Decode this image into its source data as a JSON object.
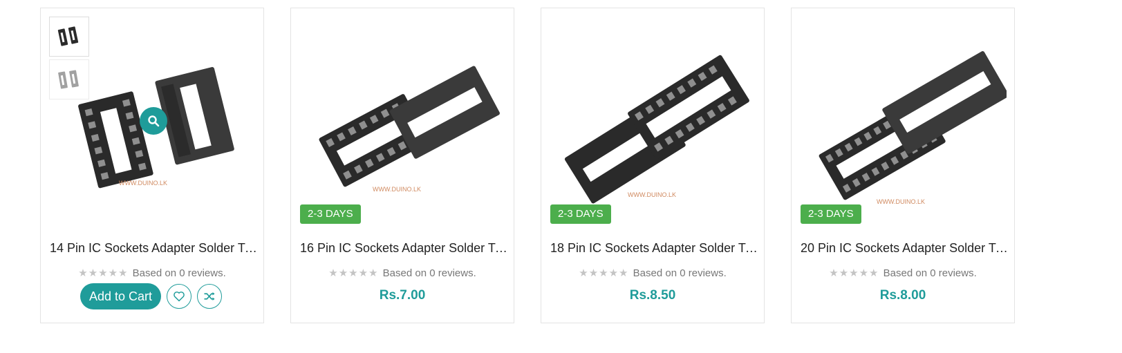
{
  "products": [
    {
      "title": "14 Pin IC Sockets Adapter Solder Ty...",
      "rating_text": "Based on 0 reviews.",
      "stars": "★★★★★",
      "watermark": "WWW.DUINO.LK",
      "action_label": "Add to Cart",
      "icons": [
        "search-icon",
        "heart-icon",
        "shuffle-icon"
      ]
    },
    {
      "title": "16 Pin IC Sockets Adapter Solder Ty...",
      "rating_text": "Based on 0 reviews.",
      "stars": "★★★★★",
      "badge": "2-3 DAYS",
      "price": "Rs.7.00",
      "watermark": "WWW.DUINO.LK"
    },
    {
      "title": "18 Pin IC Sockets Adapter Solder Ty...",
      "rating_text": "Based on 0 reviews.",
      "stars": "★★★★★",
      "badge": "2-3 DAYS",
      "price": "Rs.8.50",
      "watermark": "WWW.DUINO.LK"
    },
    {
      "title": "20 Pin IC Sockets Adapter Solder Ty...",
      "rating_text": "Based on 0 reviews.",
      "stars": "★★★★★",
      "badge": "2-3 DAYS",
      "price": "Rs.8.00",
      "watermark": "WWW.DUINO.LK"
    }
  ],
  "colors": {
    "accent": "#1f9c9a",
    "badge": "#4cae4c",
    "star": "#c4c4c4"
  }
}
